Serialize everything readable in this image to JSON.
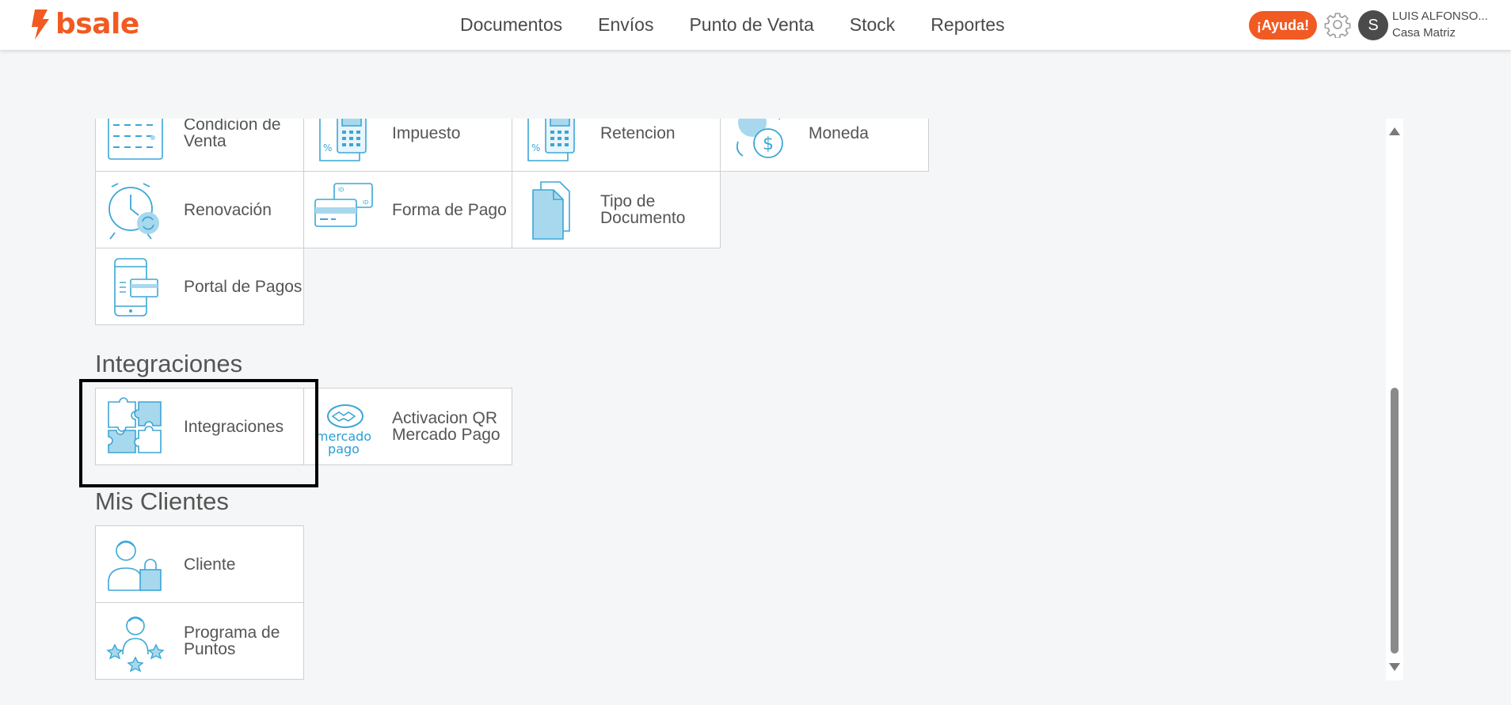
{
  "brand": {
    "name": "bsale",
    "color": "#f15a22"
  },
  "nav": {
    "items": [
      "Documentos",
      "Envíos",
      "Punto de Venta",
      "Stock",
      "Reportes"
    ]
  },
  "header": {
    "help_label": "¡Ayuda!",
    "settings_icon": "gear-icon",
    "avatar_initial": "S",
    "user_name": "LUIS ALFONSO...",
    "user_branch": "Casa Matriz"
  },
  "config_tiles": [
    {
      "label": "Condicion de Venta",
      "icon": "calendar-icon"
    },
    {
      "label": "Impuesto",
      "icon": "tax-calculator-icon"
    },
    {
      "label": "Retencion",
      "icon": "retention-calculator-icon"
    },
    {
      "label": "Moneda",
      "icon": "currency-exchange-icon"
    },
    {
      "label": "Renovación",
      "icon": "renewal-clock-icon"
    },
    {
      "label": "Forma de Pago",
      "icon": "payment-cards-icon"
    },
    {
      "label": "Tipo de Documento",
      "icon": "document-icon"
    },
    {
      "label": "Portal de Pagos",
      "icon": "mobile-payment-icon"
    }
  ],
  "integraciones": {
    "title": "Integraciones",
    "tiles": [
      {
        "label": "Integraciones",
        "icon": "puzzle-icon"
      },
      {
        "label": "Activacion QR Mercado Pago",
        "icon": "mercado-pago-logo",
        "logo_text": "mercado pago"
      }
    ]
  },
  "mis_clientes": {
    "title": "Mis Clientes",
    "tiles": [
      {
        "label": "Cliente",
        "icon": "customer-icon"
      },
      {
        "label": "Programa de Puntos",
        "icon": "loyalty-stars-icon"
      }
    ]
  }
}
